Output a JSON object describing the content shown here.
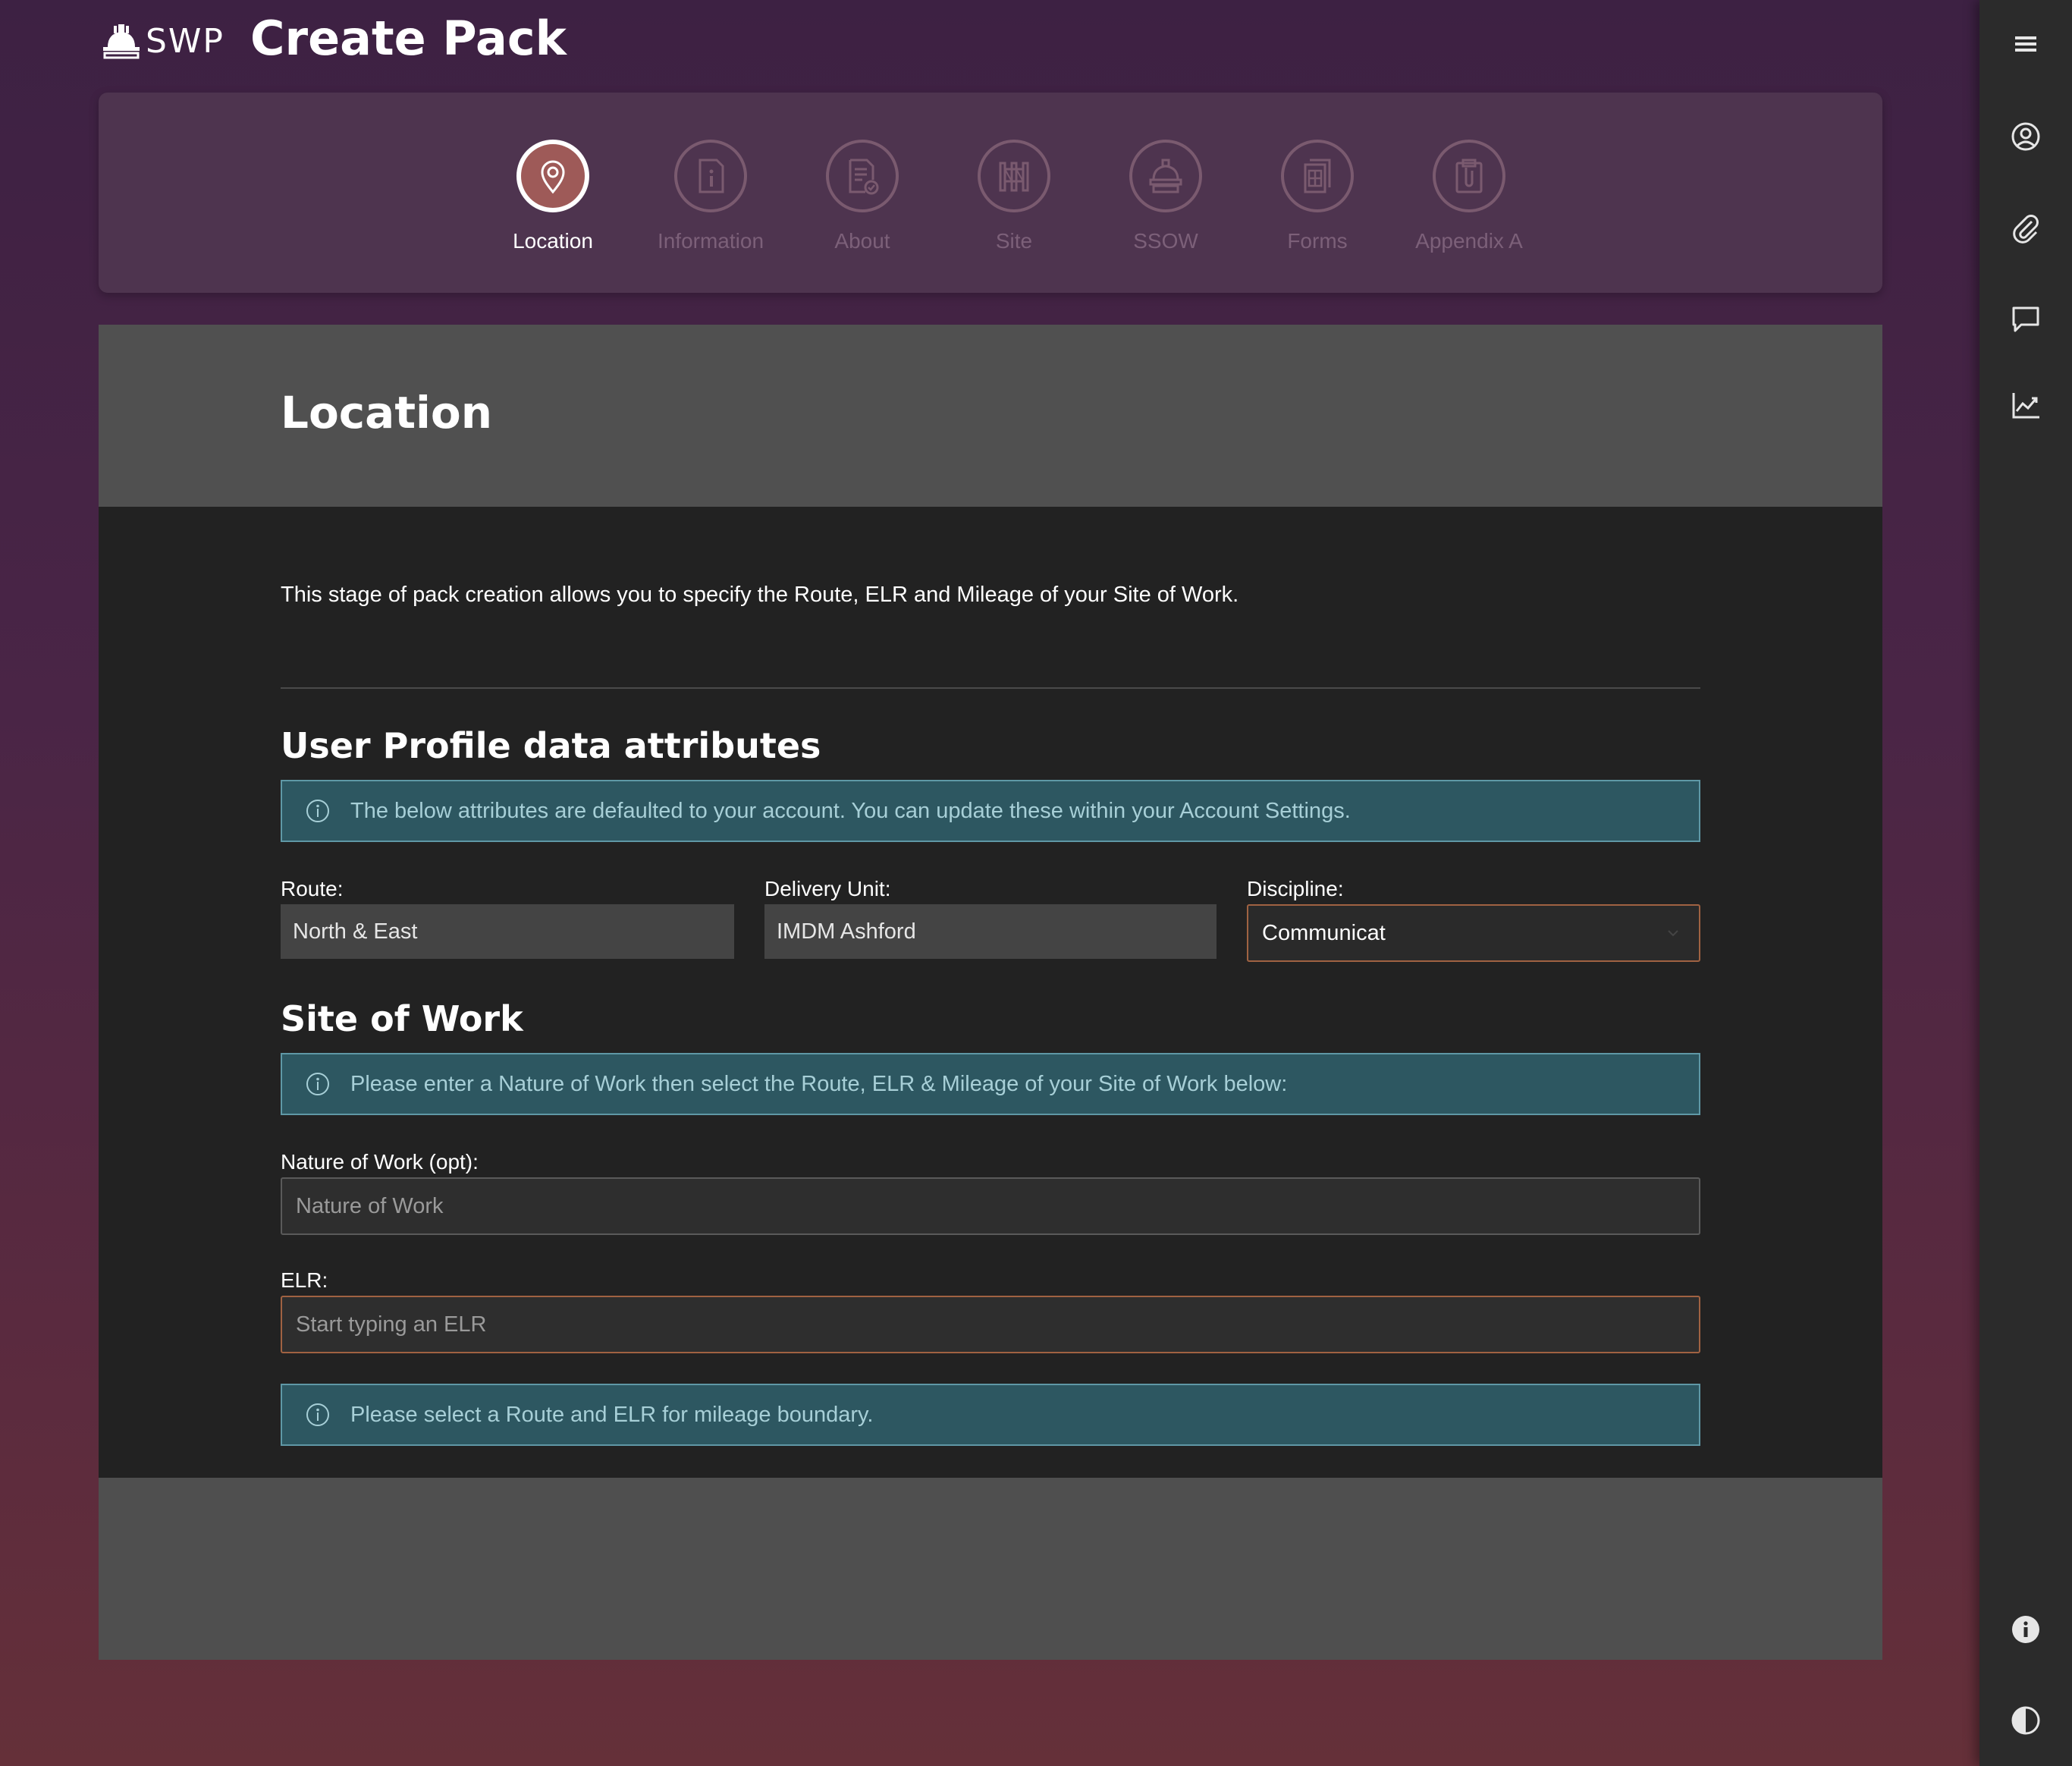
{
  "header": {
    "logo_text": "SWP",
    "title": "Create Pack"
  },
  "stepper": {
    "steps": [
      {
        "label": "Location",
        "icon": "map-pin-icon",
        "active": true
      },
      {
        "label": "Information",
        "icon": "info-document-icon",
        "active": false
      },
      {
        "label": "About",
        "icon": "document-check-icon",
        "active": false
      },
      {
        "label": "Site",
        "icon": "fence-icon",
        "active": false
      },
      {
        "label": "SSOW",
        "icon": "hard-hat-icon",
        "active": false
      },
      {
        "label": "Forms",
        "icon": "forms-icon",
        "active": false
      },
      {
        "label": "Appendix A",
        "icon": "clipboard-attachment-icon",
        "active": false
      }
    ]
  },
  "main": {
    "title": "Location",
    "intro": "This stage of pack creation allows you to specify the Route, ELR and Mileage of your Site of Work.",
    "profile_section": {
      "title": "User Profile data attributes",
      "alert": "The below attributes are defaulted to your account. You can update these within your Account Settings.",
      "route_label": "Route:",
      "route_value": "North & East",
      "delivery_label": "Delivery Unit:",
      "delivery_value": "IMDM Ashford",
      "discipline_label": "Discipline:",
      "discipline_value": "Communicat"
    },
    "site_section": {
      "title": "Site of Work",
      "alert": "Please enter a Nature of Work then select the Route, ELR & Mileage of your Site of Work below:",
      "nature_label": "Nature of Work (opt):",
      "nature_placeholder": "Nature of Work",
      "elr_label": "ELR:",
      "elr_placeholder": "Start typing an ELR",
      "mileage_alert": "Please select a Route and ELR for mileage boundary."
    }
  },
  "sidebar": {
    "items": [
      "menu-icon",
      "user-account-icon",
      "attachment-icon",
      "comment-icon",
      "chart-icon",
      "info-icon",
      "contrast-icon"
    ]
  },
  "colors": {
    "active_step": "#9e5a58",
    "alert_bg": "#2d5761",
    "alert_text": "#a7cfd7",
    "focus_border": "#a06242"
  }
}
